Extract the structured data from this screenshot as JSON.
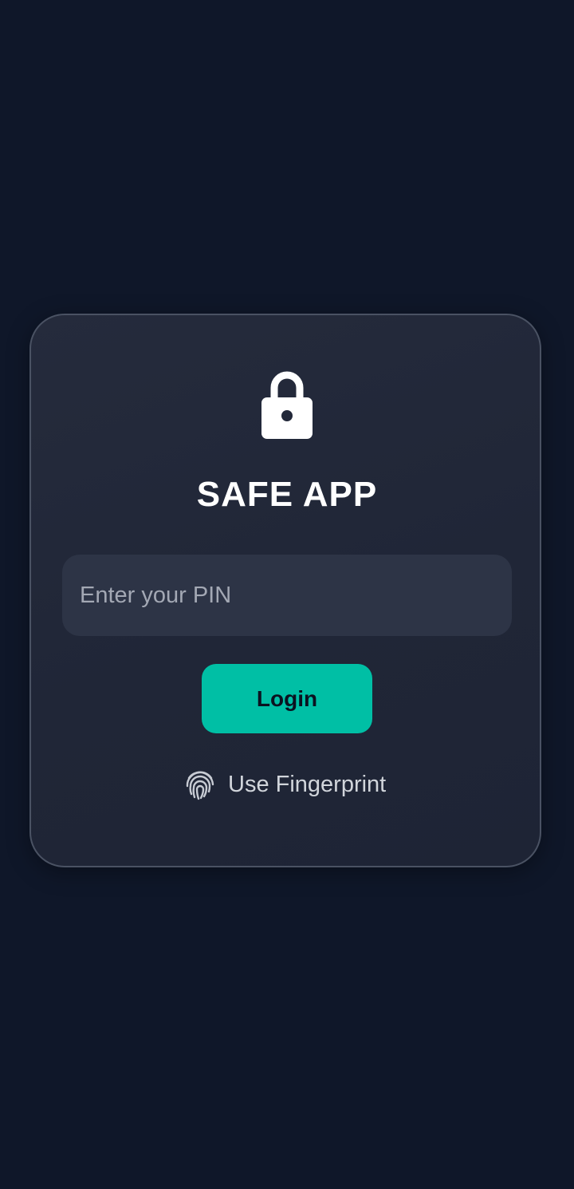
{
  "app": {
    "title": "SAFE APP"
  },
  "icons": {
    "lock": "lock-icon",
    "fingerprint": "fingerprint-icon"
  },
  "pin_input": {
    "value": "",
    "placeholder": "Enter your PIN"
  },
  "login_button": {
    "label": "Login"
  },
  "fingerprint": {
    "label": "Use Fingerprint"
  },
  "colors": {
    "background": "#0f1729",
    "card": "#222839",
    "input": "#2d3446",
    "accent": "#00bfa5",
    "text_primary": "#ffffff",
    "text_secondary": "#d1d5db"
  }
}
